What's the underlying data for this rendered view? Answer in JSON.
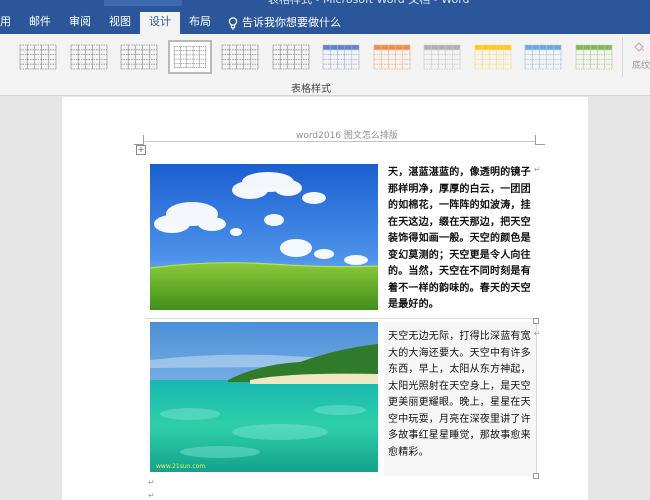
{
  "window": {
    "title": "表格样式 - Microsoft Word 文档 - Word"
  },
  "ribbon_tabs": [
    {
      "label": "用",
      "active": false
    },
    {
      "label": "邮件",
      "active": false
    },
    {
      "label": "审阅",
      "active": false
    },
    {
      "label": "视图",
      "active": false
    },
    {
      "label": "设计",
      "active": true
    },
    {
      "label": "布局",
      "active": false
    }
  ],
  "tell_me": {
    "placeholder": "告诉我你想要做什么",
    "icon": "lightbulb-icon"
  },
  "table_styles": {
    "group_label": "表格样式",
    "selected_index": 3,
    "styles": [
      {
        "name": "plain-grid-1",
        "line_color": "#8a8a8a",
        "header_color": "#8a8a8a"
      },
      {
        "name": "plain-grid-2",
        "line_color": "#8a8a8a",
        "header_color": "#8a8a8a"
      },
      {
        "name": "plain-grid-3",
        "line_color": "#8a8a8a",
        "header_color": "#8a8a8a"
      },
      {
        "name": "plain-grid-4",
        "line_color": "#8a8a8a",
        "header_color": "#8a8a8a"
      },
      {
        "name": "plain-grid-5",
        "line_color": "#8a8a8a",
        "header_color": "#8a8a8a"
      },
      {
        "name": "grid-table-dark",
        "line_color": "#8a8a8a",
        "header_color": "#5a5a5a"
      },
      {
        "name": "grid-table-blue",
        "line_color": "#9cb3d8",
        "header_color": "#4472c4"
      },
      {
        "name": "grid-table-orange",
        "line_color": "#f4b183",
        "header_color": "#ed7d31"
      },
      {
        "name": "grid-table-gray",
        "line_color": "#c9c9c9",
        "header_color": "#a5a5a5"
      },
      {
        "name": "grid-table-gold",
        "line_color": "#ffd966",
        "header_color": "#ffc000"
      },
      {
        "name": "grid-table-accent",
        "line_color": "#9dc3e6",
        "header_color": "#5b9bd5"
      },
      {
        "name": "grid-table-green",
        "line_color": "#a9d08e",
        "header_color": "#70ad47"
      }
    ]
  },
  "shading": {
    "label": "底纹",
    "icon": "paint-bucket-icon"
  },
  "document": {
    "header_text": "word2016 图文怎么排版",
    "rows": [
      {
        "image": "sky-clouds-grassland-photo",
        "text": "天，湛蓝湛蓝的，像透明的镜子那样明净，厚厚的白云，一团团的如棉花，一阵阵的如波涛，挂在天这边，缀在天那边，把天空装饰得如画一般。天空的颜色是变幻莫测的；天空更是令人向往的。当然，天空在不同时刻是有着不一样的韵味的。春天的天空是最好的。",
        "bold": true
      },
      {
        "image": "tropical-sea-island-photo",
        "image_watermark": "www.21sun.com",
        "text": "天空无边无际，打得比深蓝有宽大的大海还要大。天空中有许多东西，早上，太阳从东方神起，太阳光照射在天空身上，是天空更美丽更耀眼。晚上，星星在天空中玩耍，月亮在深夜里讲了许多故事红星星睡觉，那故事愈来愈精彩。",
        "bold": false
      }
    ]
  }
}
